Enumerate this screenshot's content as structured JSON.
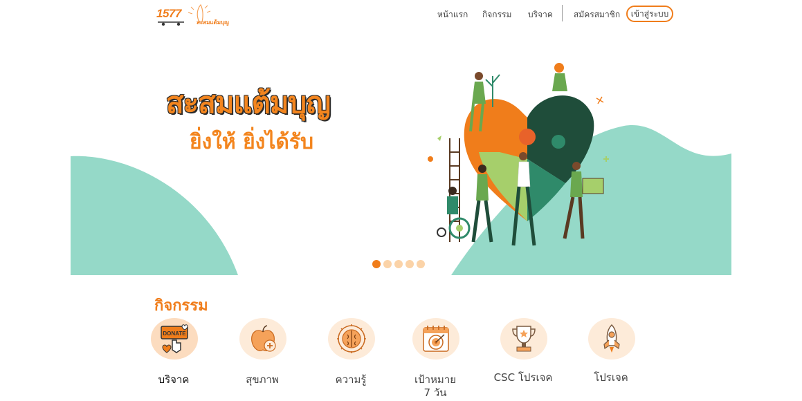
{
  "header": {
    "logo_number": "1577",
    "logo_text": "สะสมแต้มบุญ",
    "nav": [
      {
        "label": "หน้าแรก"
      },
      {
        "label": "กิจกรรม"
      },
      {
        "label": "บริจาค"
      },
      {
        "label": "สมัครสมาชิก"
      }
    ],
    "login_label": "เข้าสู่ระบบ"
  },
  "banner": {
    "title": "สะสมแต้มบุญ",
    "subtitle": "ยิ่งให้ ยิ่งได้รับ",
    "slides_total": 5,
    "active_slide": 1
  },
  "activities": {
    "title": "กิจกรรม",
    "items": [
      {
        "label": "บริจาค",
        "icon": "donate-icon"
      },
      {
        "label": "สุขภาพ",
        "icon": "health-apple-icon"
      },
      {
        "label": "ความรู้",
        "icon": "brain-knowledge-icon"
      },
      {
        "label": "เป้าหมาย\n7 วัน",
        "line1": "เป้าหมาย",
        "line2": "7 วัน",
        "icon": "target-calendar-icon"
      },
      {
        "label": "CSC โปรเจค",
        "icon": "trophy-icon"
      },
      {
        "label": "โปรเจค",
        "icon": "rocket-icon"
      }
    ]
  },
  "colors": {
    "brand_orange": "#f07d1b",
    "mint": "#95d9c8",
    "dark_green": "#1f4d3a",
    "icon_bg": "#fdebd9"
  }
}
